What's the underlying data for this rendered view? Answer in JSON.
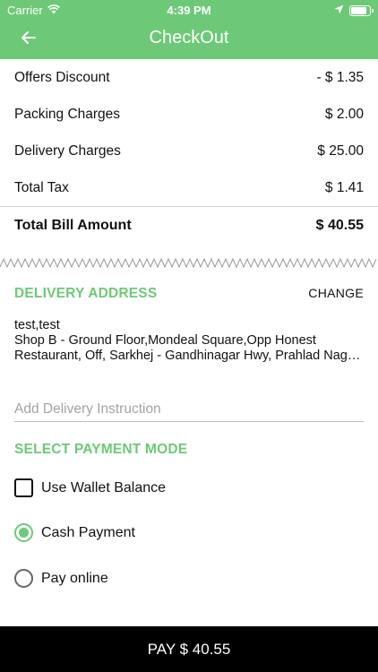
{
  "status_bar": {
    "carrier": "Carrier",
    "time": "4:39 PM"
  },
  "header": {
    "title": "CheckOut"
  },
  "summary": {
    "rows": [
      {
        "label": "Offers Discount",
        "value": "- $ 1.35"
      },
      {
        "label": "Packing Charges",
        "value": "$ 2.00"
      },
      {
        "label": "Delivery Charges",
        "value": "$ 25.00"
      },
      {
        "label": "Total Tax",
        "value": "$ 1.41"
      }
    ],
    "total_label": "Total Bill Amount",
    "total_value": "$ 40.55"
  },
  "delivery": {
    "title": "DELIVERY ADDRESS",
    "change_label": "CHANGE",
    "name": "test,test",
    "address": "Shop B - Ground Floor,Mondeal Square,Opp Honest Restaurant, Off, Sarkhej - Gandhinagar Hwy, Prahlad Nagar, Ahmedabad"
  },
  "instruction": {
    "placeholder": "Add Delivery Instruction"
  },
  "payment": {
    "title": "SELECT PAYMENT MODE",
    "wallet_label": "Use Wallet Balance",
    "cash_label": "Cash Payment",
    "online_label": "Pay online",
    "selected": "cash"
  },
  "pay_button": {
    "label": "PAY $ 40.55"
  },
  "colors": {
    "accent": "#6dc977",
    "pay_bar": "#000000"
  }
}
